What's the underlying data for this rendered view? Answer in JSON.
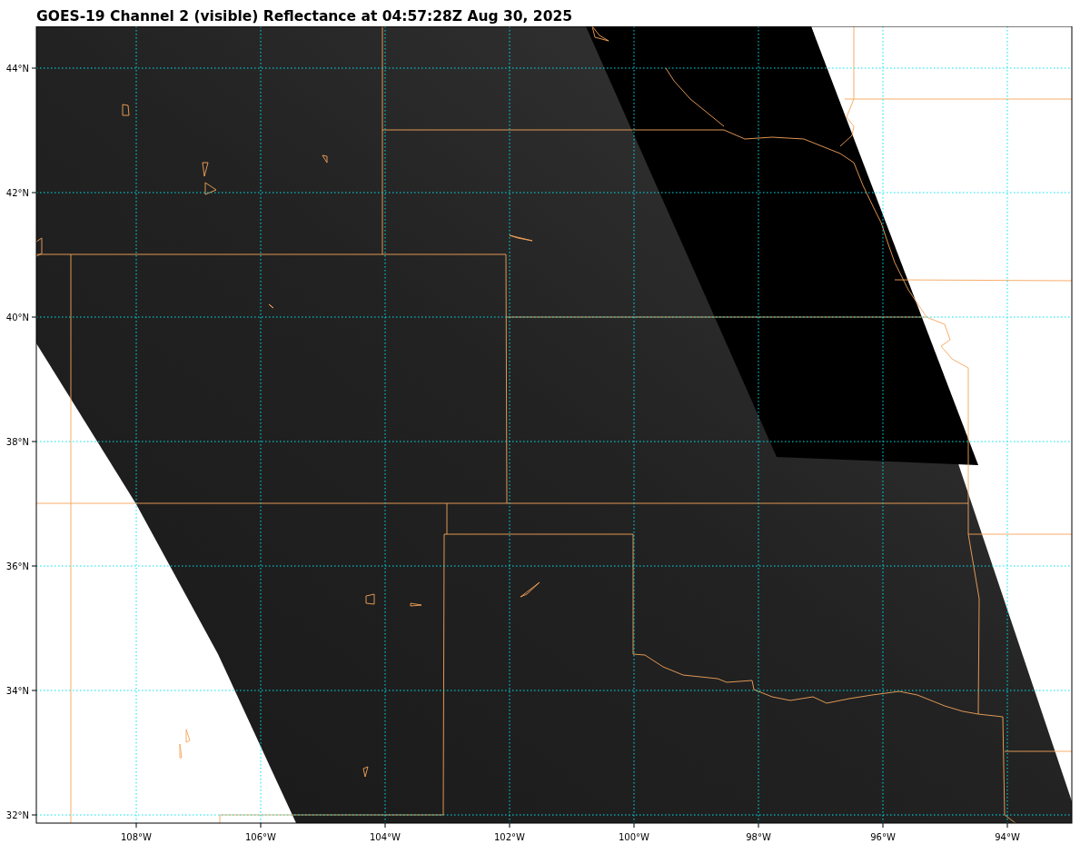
{
  "title": "GOES-19 Channel 2 (visible) Reflectance at 04:57:28Z Aug 30, 2025",
  "map": {
    "lat_labels": [
      "44°N",
      "42°N",
      "40°N",
      "38°N",
      "36°N",
      "34°N",
      "32°N"
    ],
    "lon_labels": [
      "108°W",
      "106°W",
      "104°W",
      "102°W",
      "100°W",
      "98°W",
      "96°W",
      "94°W"
    ]
  }
}
